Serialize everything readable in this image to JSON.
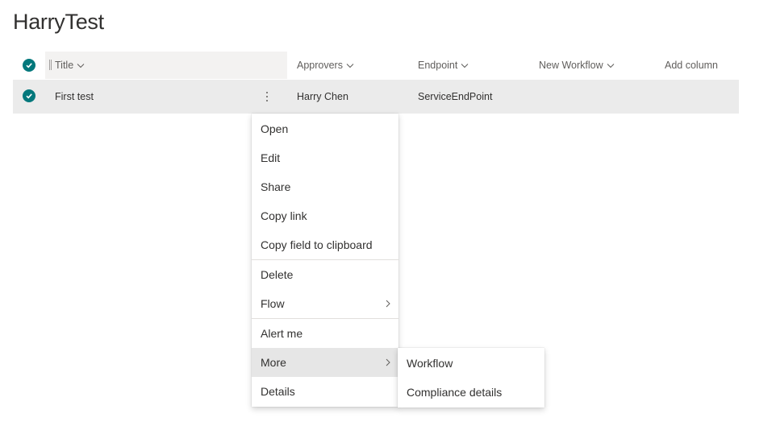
{
  "page": {
    "title": "HarryTest"
  },
  "columns": {
    "title": "Title",
    "approvers": "Approvers",
    "endpoint": "Endpoint",
    "new_workflow": "New Workflow",
    "add_column": "Add column"
  },
  "row": {
    "title": "First test",
    "approvers": "Harry Chen",
    "endpoint": "ServiceEndPoint"
  },
  "context_menu": {
    "items": [
      "Open",
      "Edit",
      "Share",
      "Copy link",
      "Copy field to clipboard",
      "Delete",
      "Flow",
      "Alert me",
      "More",
      "Details"
    ]
  },
  "submenu": {
    "items": [
      "Workflow",
      "Compliance details"
    ]
  },
  "colors": {
    "accent": "#03787c",
    "row_selected": "#ebebeb",
    "header_highlight": "#f3f2f1"
  },
  "icons": [
    "check-circle-icon",
    "chevron-down-icon",
    "more-vertical-icon",
    "chevron-right-icon"
  ]
}
